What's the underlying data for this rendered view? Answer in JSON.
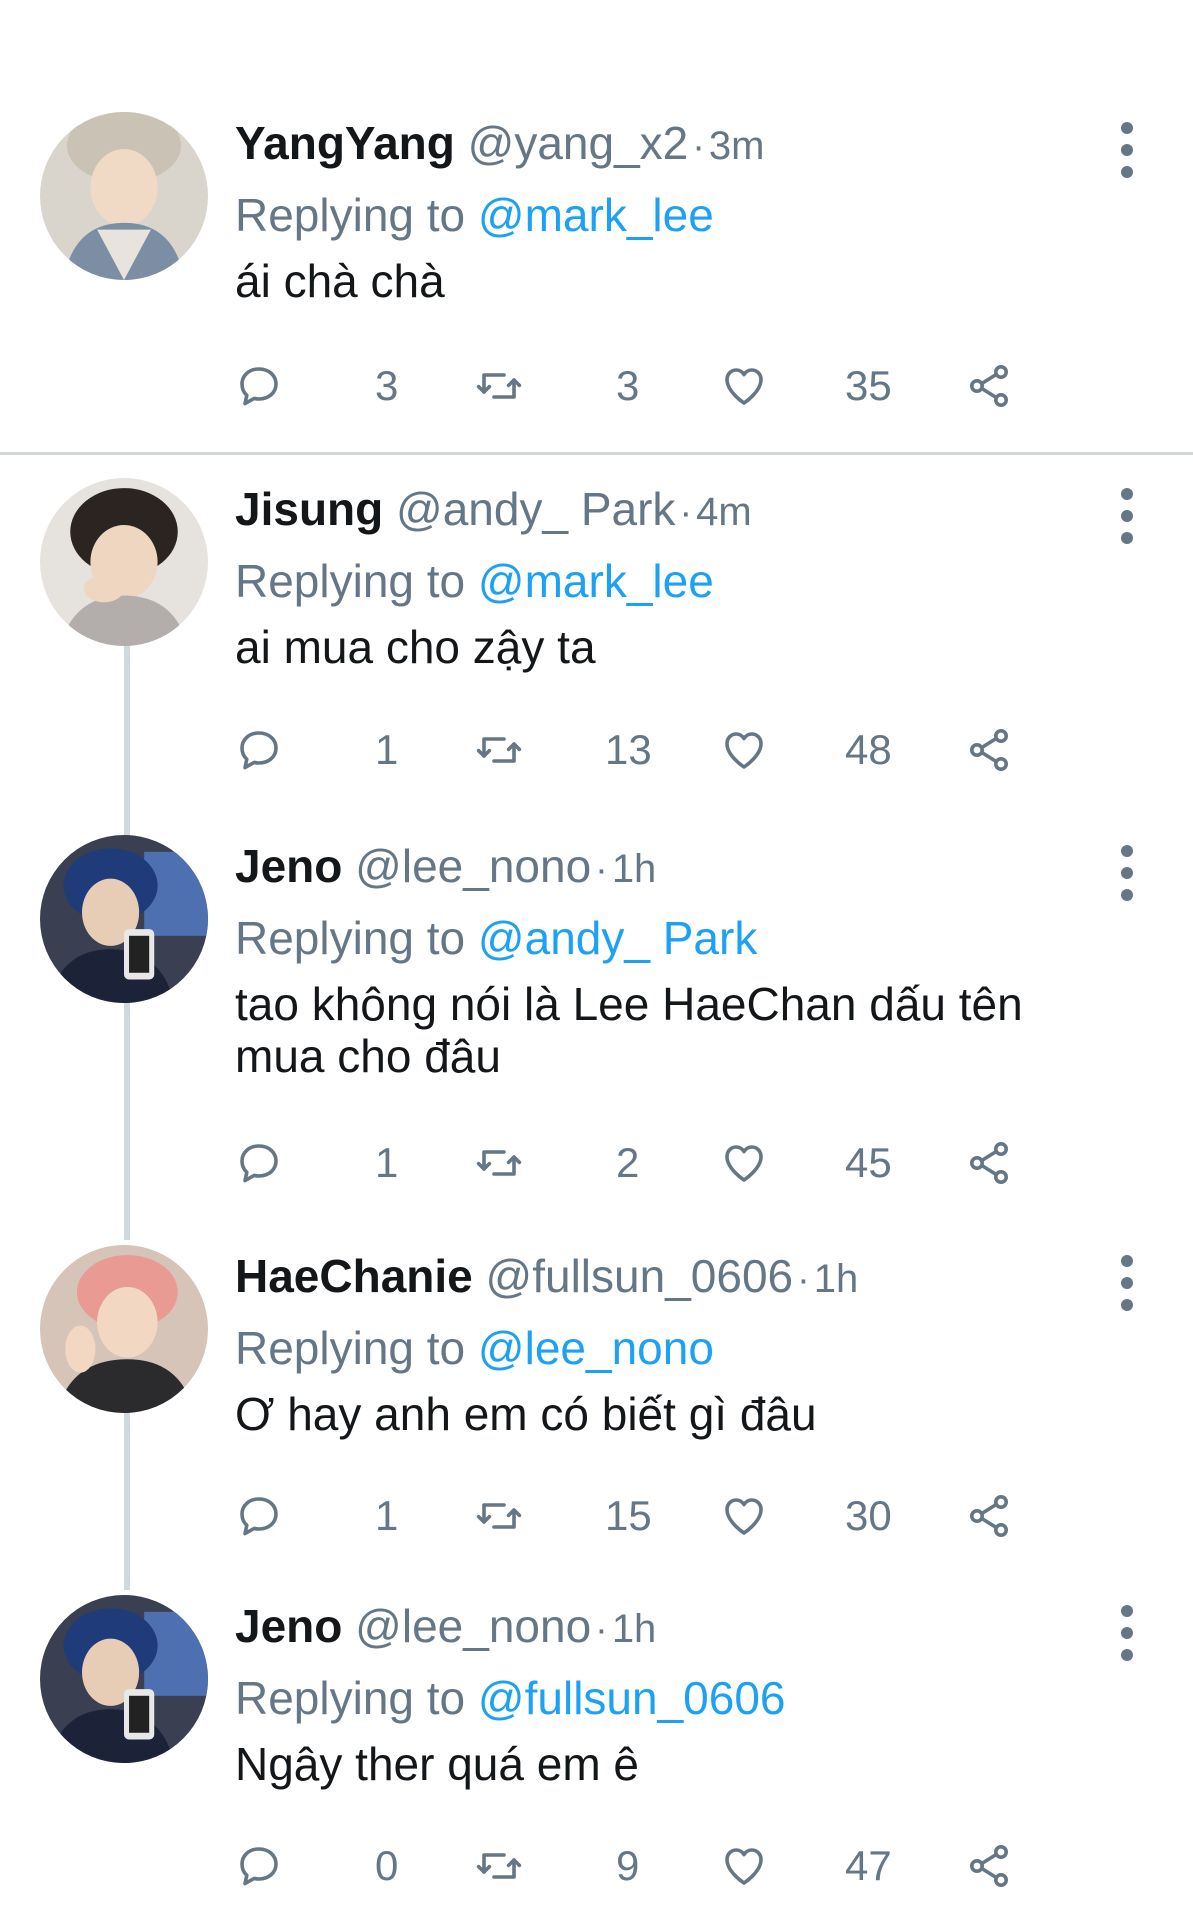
{
  "tweets": [
    {
      "name": "YangYang",
      "handle": "@yang_x2",
      "time": "3m",
      "replying_label": "Replying to",
      "replying_to": "@mark_lee",
      "text": "ái chà chà",
      "replies": "3",
      "retweets": "3",
      "likes": "35"
    },
    {
      "name": "Jisung",
      "handle": "@andy_ Park",
      "time": "4m",
      "replying_label": "Replying to",
      "replying_to": "@mark_lee",
      "text": "ai mua cho zậy ta",
      "replies": "1",
      "retweets": "13",
      "likes": "48"
    },
    {
      "name": "Jeno",
      "handle": "@lee_nono",
      "time": "1h",
      "replying_label": "Replying to",
      "replying_to": "@andy_ Park",
      "text": "tao không nói là Lee HaeChan dấu tên mua cho đâu",
      "replies": "1",
      "retweets": "2",
      "likes": "45"
    },
    {
      "name": "HaeChanie",
      "handle": "@fullsun_0606",
      "time": "1h",
      "replying_label": "Replying to",
      "replying_to": "@lee_nono",
      "text": "Ơ hay anh em có biết gì đâu",
      "replies": "1",
      "retweets": "15",
      "likes": "30"
    },
    {
      "name": "Jeno",
      "handle": "@lee_nono",
      "time": "1h",
      "replying_label": "Replying to",
      "replying_to": "@fullsun_0606",
      "text": "Ngây ther quá em ê",
      "replies": "0",
      "retweets": "9",
      "likes": "47"
    }
  ],
  "colors": {
    "link": "#1da1f2",
    "muted": "#657786",
    "text": "#14171a",
    "thread_line": "#cfd9de"
  },
  "icons": [
    "reply-icon",
    "retweet-icon",
    "like-icon",
    "share-icon",
    "more-options-icon"
  ],
  "dot_separator": "·"
}
